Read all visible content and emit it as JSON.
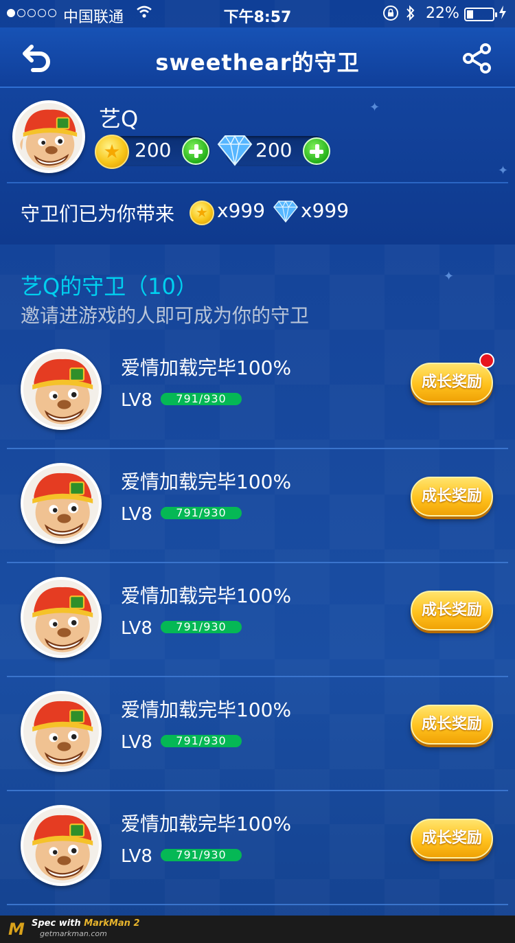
{
  "status_bar": {
    "carrier": "中国联通",
    "time": "下午8:57",
    "battery_pct": "22%"
  },
  "nav": {
    "title": "sweethear的守卫"
  },
  "profile": {
    "name": "艺Q",
    "coins": "200",
    "diamonds": "200",
    "brought_label": "守卫们已为你带来",
    "brought_coins": "x999",
    "brought_diamonds": "x999"
  },
  "section": {
    "title": "艺Q的守卫（10）",
    "subtitle": "邀请进游戏的人即可成为你的守卫"
  },
  "guardians": [
    {
      "title": "爱情加载完毕100%",
      "level": "LV8",
      "progress": "791/930",
      "progress_fraction": 0.85,
      "button": "成长奖励",
      "has_badge": true
    },
    {
      "title": "爱情加载完毕100%",
      "level": "LV8",
      "progress": "791/930",
      "progress_fraction": 0.85,
      "button": "成长奖励",
      "has_badge": false
    },
    {
      "title": "爱情加载完毕100%",
      "level": "LV8",
      "progress": "791/930",
      "progress_fraction": 0.85,
      "button": "成长奖励",
      "has_badge": false
    },
    {
      "title": "爱情加载完毕100%",
      "level": "LV8",
      "progress": "791/930",
      "progress_fraction": 0.85,
      "button": "成长奖励",
      "has_badge": false
    },
    {
      "title": "爱情加载完毕100%",
      "level": "LV8",
      "progress": "791/930",
      "progress_fraction": 0.85,
      "button": "成长奖励",
      "has_badge": false
    }
  ],
  "footer": {
    "brand_prefix": "Spec with ",
    "brand_name": "MarkMan 2",
    "url": "getmarkman.com"
  },
  "colors": {
    "section_title": "#00d0ef",
    "progress_bar": "#05b855",
    "subtitle": "#b9c5d8"
  }
}
